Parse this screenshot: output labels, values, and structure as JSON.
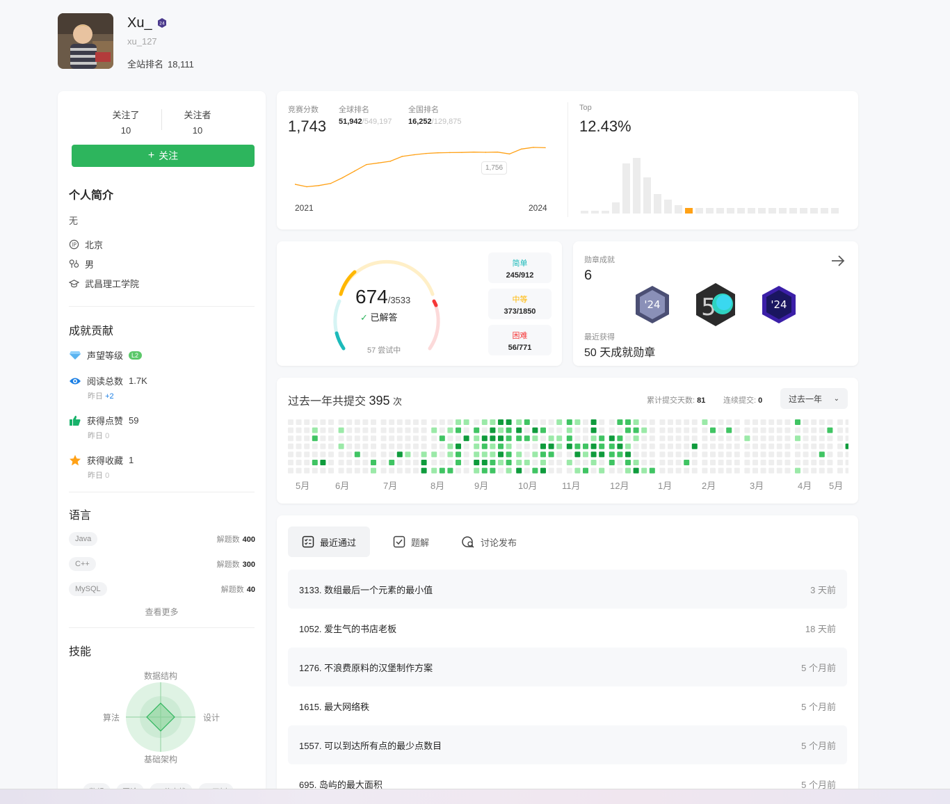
{
  "profile": {
    "name": "Xu_",
    "handle": "xu_127",
    "rank_label": "全站排名",
    "rank_value": "18,111"
  },
  "follow": {
    "following_label": "关注了",
    "following_count": "10",
    "followers_label": "关注者",
    "followers_count": "10",
    "button_label": "关注",
    "button_icon": "plus-icon"
  },
  "bio": {
    "title": "个人简介",
    "text": "无",
    "location": "北京",
    "gender": "男",
    "school": "武昌理工学院"
  },
  "achievements": {
    "title": "成就贡献",
    "reputation_label": "声望等级",
    "reputation_badge": "L2",
    "views_label": "阅读总数",
    "views_value": "1.7K",
    "views_yesterday_label": "昨日",
    "views_yesterday_value": "+2",
    "likes_label": "获得点赞",
    "likes_value": "59",
    "likes_yesterday_label": "昨日",
    "likes_yesterday_value": "0",
    "favs_label": "获得收藏",
    "favs_value": "1",
    "favs_yesterday_label": "昨日",
    "favs_yesterday_value": "0"
  },
  "languages": {
    "title": "语言",
    "count_label": "解题数",
    "items": [
      {
        "name": "Java",
        "count": "400"
      },
      {
        "name": "C++",
        "count": "300"
      },
      {
        "name": "MySQL",
        "count": "40"
      }
    ],
    "more_label": "查看更多"
  },
  "skills": {
    "title": "技能",
    "axes": [
      "数据结构",
      "设计",
      "基础架构",
      "算法"
    ],
    "tags": [
      "数组",
      "图论",
      "二分查找",
      "二叉树"
    ]
  },
  "contest": {
    "score_label": "竞赛分数",
    "score": "1,743",
    "global_label": "全球排名",
    "global_rank": "51,942",
    "global_total": "/549,197",
    "national_label": "全国排名",
    "national_rank": "16,252",
    "national_total": "/129,875",
    "start_year": "2021",
    "end_year": "2024",
    "tooltip": "1,756",
    "top_label": "Top",
    "top_value": "12.43%"
  },
  "chart_data": [
    {
      "type": "line",
      "title": "",
      "x": [
        "2021",
        "2024"
      ],
      "series": [
        {
          "values": [
            1520,
            1505,
            1512,
            1525,
            1560,
            1600,
            1640,
            1650,
            1660,
            1690,
            1700,
            1708,
            1712,
            1713,
            1714,
            1716,
            1715,
            1716,
            1705,
            1735,
            1745,
            1743
          ]
        }
      ],
      "annotation": "1,756",
      "color": "#ffa116"
    },
    {
      "type": "bar",
      "title": "",
      "values": [
        1,
        1,
        1,
        4,
        18,
        20,
        13,
        7,
        5,
        3,
        2,
        2,
        2,
        2,
        2,
        2,
        2,
        2,
        2,
        2,
        2,
        2,
        2,
        2,
        2
      ],
      "highlight_index": 10,
      "highlight_color": "#ffa116"
    }
  ],
  "problems": {
    "solved": "674",
    "total": "/3533",
    "solved_label": "已解答",
    "attempting": "57 尝试中",
    "easy_label": "简单",
    "easy_value": "245/912",
    "medium_label": "中等",
    "medium_value": "373/1850",
    "hard_label": "困难",
    "hard_value": "56/771",
    "easy_color": "#1cbaba",
    "medium_color": "#ffb700",
    "hard_color": "#f63737"
  },
  "badges": {
    "title": "勋章成就",
    "count": "6",
    "recent_label": "最近获得",
    "recent_name": "50 天成就勋章",
    "items": [
      "2024-badge-icon",
      "50-days-badge-icon",
      "2024-purple-badge-icon"
    ]
  },
  "heatmap": {
    "prefix": "过去一年共提交",
    "total": "395",
    "suffix": "次",
    "days_label": "累计提交天数:",
    "days_value": "81",
    "streak_label": "连续提交:",
    "streak_value": "0",
    "range_label": "过去一年",
    "months": [
      "5月",
      "6月",
      "7月",
      "8月",
      "9月",
      "10月",
      "11月",
      "12月",
      "1月",
      "2月",
      "3月",
      "4月",
      "5月"
    ]
  },
  "recent": {
    "tabs": [
      {
        "label": "最近通过",
        "icon": "checklist-icon"
      },
      {
        "label": "题解",
        "icon": "checkbox-icon"
      },
      {
        "label": "讨论发布",
        "icon": "discussion-icon"
      }
    ],
    "items": [
      {
        "title": "3133. 数组最后一个元素的最小值",
        "time": "3 天前"
      },
      {
        "title": "1052. 爱生气的书店老板",
        "time": "18 天前"
      },
      {
        "title": "1276. 不浪费原料的汉堡制作方案",
        "time": "5 个月前"
      },
      {
        "title": "1615. 最大网络秩",
        "time": "5 个月前"
      },
      {
        "title": "1557. 可以到达所有点的最少点数目",
        "time": "5 个月前"
      },
      {
        "title": "695. 岛屿的最大面积",
        "time": "5 个月前"
      }
    ]
  }
}
